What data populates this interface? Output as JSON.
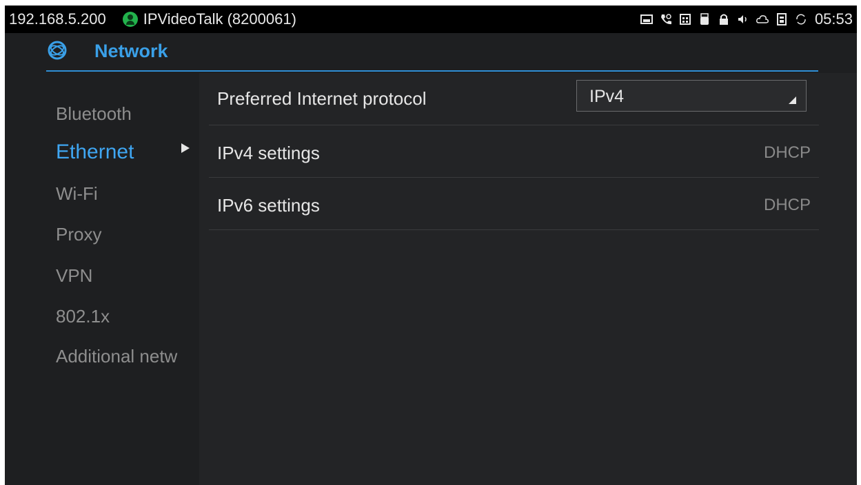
{
  "status_bar": {
    "ip": "192.168.5.200",
    "account_label": "IPVideoTalk (8200061)",
    "account_icon": "user-circle-icon",
    "icons": [
      "image-icon",
      "phone-icon",
      "calendar-icon",
      "usb-icon",
      "lock-icon",
      "volume-icon",
      "cloud-icon",
      "sim-icon",
      "sync-icon"
    ],
    "time": "05:53"
  },
  "header": {
    "icon": "network-icon",
    "title": "Network",
    "accent_color": "#3aa0e8"
  },
  "sidebar": {
    "items": [
      {
        "label": "Bluetooth",
        "active": false
      },
      {
        "label": "Ethernet",
        "active": true
      },
      {
        "label": "Wi-Fi",
        "active": false
      },
      {
        "label": "Proxy",
        "active": false
      },
      {
        "label": "VPN",
        "active": false
      },
      {
        "label": "802.1x",
        "active": false
      },
      {
        "label": "Additional netw",
        "active": false
      }
    ]
  },
  "main": {
    "rows": [
      {
        "label": "Preferred Internet protocol",
        "select_value": "IPv4"
      },
      {
        "label": "IPv4 settings",
        "value": "DHCP"
      },
      {
        "label": "IPv6 settings",
        "value": "DHCP"
      }
    ]
  }
}
